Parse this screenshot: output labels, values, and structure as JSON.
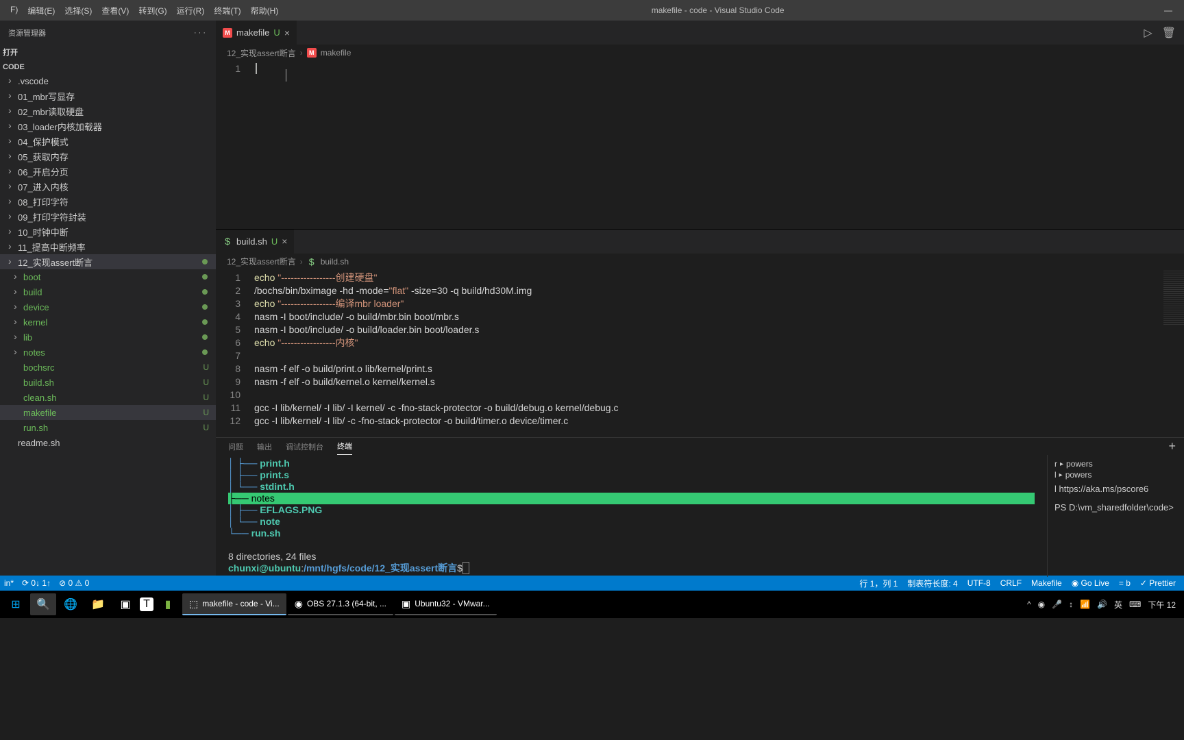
{
  "window": {
    "title": "makefile - code - Visual Studio Code",
    "menus": [
      "F)",
      "编辑(E)",
      "选择(S)",
      "查看(V)",
      "转到(G)",
      "运行(R)",
      "终端(T)",
      "帮助(H)"
    ]
  },
  "sidebar": {
    "header": "资源管理器",
    "more": "···",
    "section1": "打开",
    "section2": "CODE",
    "items": [
      {
        "label": ".vscode",
        "type": "folder"
      },
      {
        "label": "01_mbr写显存",
        "type": "folder"
      },
      {
        "label": "02_mbr读取硬盘",
        "type": "folder"
      },
      {
        "label": "03_loader内核加载器",
        "type": "folder"
      },
      {
        "label": "04_保护模式",
        "type": "folder"
      },
      {
        "label": "05_获取内存",
        "type": "folder"
      },
      {
        "label": "06_开启分页",
        "type": "folder"
      },
      {
        "label": "07_进入内核",
        "type": "folder"
      },
      {
        "label": "08_打印字符",
        "type": "folder"
      },
      {
        "label": "09_打印字符封装",
        "type": "folder"
      },
      {
        "label": "10_时钟中断",
        "type": "folder"
      },
      {
        "label": "11_提高中断频率",
        "type": "folder"
      },
      {
        "label": "12_实现assert断言",
        "type": "folder",
        "active": true,
        "git": "dot"
      },
      {
        "label": "boot",
        "type": "folder",
        "green": true,
        "git": "dot",
        "indent": true
      },
      {
        "label": "build",
        "type": "folder",
        "green": true,
        "git": "dot",
        "indent": true
      },
      {
        "label": "device",
        "type": "folder",
        "green": true,
        "git": "dot",
        "indent": true
      },
      {
        "label": "kernel",
        "type": "folder",
        "green": true,
        "git": "dot",
        "indent": true
      },
      {
        "label": "lib",
        "type": "folder",
        "green": true,
        "git": "dot",
        "indent": true
      },
      {
        "label": "notes",
        "type": "folder",
        "green": true,
        "git": "dot",
        "indent": true
      },
      {
        "label": "bochsrc",
        "type": "file",
        "green": true,
        "git": "U",
        "indent": true
      },
      {
        "label": "build.sh",
        "type": "file",
        "green": true,
        "git": "U",
        "indent": true
      },
      {
        "label": "clean.sh",
        "type": "file",
        "green": true,
        "git": "U",
        "indent": true
      },
      {
        "label": "makefile",
        "type": "file",
        "green": true,
        "git": "U",
        "active": true,
        "indent": true
      },
      {
        "label": "run.sh",
        "type": "file",
        "green": true,
        "git": "U",
        "indent": true
      },
      {
        "label": "readme.sh",
        "type": "file"
      }
    ]
  },
  "editor1": {
    "tab": {
      "icon": "M",
      "name": "makefile",
      "mod": "U"
    },
    "breadcrumb": [
      "12_实现assert断言",
      "makefile"
    ],
    "lines": [
      ""
    ],
    "line_no": "1"
  },
  "editor2": {
    "tab": {
      "icon": "$",
      "name": "build.sh",
      "mod": "U"
    },
    "breadcrumb": [
      "12_实现assert断言",
      "build.sh"
    ],
    "lines": [
      {
        "n": 1,
        "t": "echo",
        "s": "\"-----------------创建硬盘\""
      },
      {
        "n": 2,
        "r": "/bochs/bin/bximage -hd -mode=\"flat\" -size=30 -q build/hd30M.img"
      },
      {
        "n": 3,
        "t": "echo",
        "s": "\"-----------------编译mbr loader\""
      },
      {
        "n": 4,
        "r": "nasm -I boot/include/ -o build/mbr.bin boot/mbr.s"
      },
      {
        "n": 5,
        "r": "nasm -I boot/include/ -o build/loader.bin boot/loader.s"
      },
      {
        "n": 6,
        "t": "echo",
        "s": "\"-----------------内核\""
      },
      {
        "n": 7,
        "r": ""
      },
      {
        "n": 8,
        "r": "nasm -f elf -o build/print.o lib/kernel/print.s"
      },
      {
        "n": 9,
        "r": "nasm -f elf -o build/kernel.o kernel/kernel.s"
      },
      {
        "n": 10,
        "r": ""
      },
      {
        "n": 11,
        "r": "gcc -I lib/kernel/ -I lib/ -I kernel/ -c -fno-stack-protector -o build/debug.o kernel/debug.c"
      },
      {
        "n": 12,
        "r": "gcc -I lib/kernel/ -I lib/ -c -fno-stack-protector -o build/timer.o device/timer.c"
      }
    ]
  },
  "panel": {
    "tabs": [
      "问题",
      "输出",
      "调试控制台",
      "终端"
    ],
    "active_tab": 3,
    "terminal_lines": [
      {
        "pre": "   │   ├── ",
        "file": "print.h"
      },
      {
        "pre": "   │   ├── ",
        "file": "print.s"
      },
      {
        "pre": "   │   └── ",
        "file": "stdint.h"
      },
      {
        "sel": true,
        "pre": "├── ",
        "file": "notes"
      },
      {
        "pre": "│   ├── ",
        "file": "EFLAGS.PNG"
      },
      {
        "pre": "│   └── ",
        "file": "note"
      },
      {
        "pre": "└── ",
        "file": "run.sh"
      }
    ],
    "summary": "8 directories, 24 files",
    "prompt_user": "chunxi@ubuntu",
    "prompt_sep": ":",
    "prompt_path": "/mnt/hgfs/code/12_实现assert断言",
    "prompt_end": "$ ",
    "side_text1": "l https://aka.ms/pscore6",
    "side_text2": "PS D:\\vm_sharedfolder\\code> ",
    "side_items": [
      {
        "marker": "r",
        "label": "powers"
      },
      {
        "marker": "l",
        "label": "powers"
      }
    ]
  },
  "statusbar": {
    "left": [
      "in*",
      "⟳ 0↓ 1↑",
      "⊘ 0 ⚠ 0"
    ],
    "right": [
      "行 1，列 1",
      "制表符长度: 4",
      "UTF-8",
      "CRLF",
      "Makefile",
      "◉ Go Live",
      "= b",
      "✓ Prettier"
    ]
  },
  "taskbar": {
    "apps": [
      {
        "label": "makefile - code - Vi...",
        "active": true
      },
      {
        "label": "OBS 27.1.3 (64-bit, ..."
      },
      {
        "label": "Ubuntu32 - VMwar..."
      }
    ],
    "time": "下午 12",
    "ime": "英",
    "search_icon": "🔍"
  }
}
